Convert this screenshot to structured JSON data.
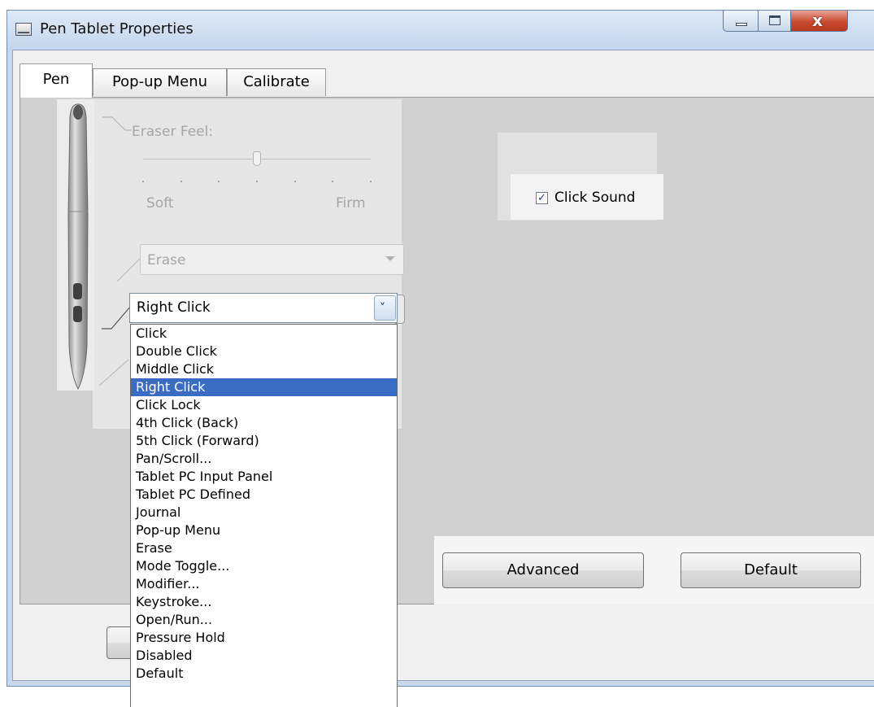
{
  "window": {
    "title": "Pen Tablet Properties"
  },
  "titlebar_buttons": [
    "minimize-icon",
    "maximize-icon",
    "close-icon"
  ],
  "close_glyph": "x",
  "tabs": [
    {
      "label": "Pen",
      "active": true
    },
    {
      "label": "Pop-up Menu",
      "active": false
    },
    {
      "label": "Calibrate",
      "active": false
    }
  ],
  "eraser_feel": {
    "label": "Eraser Feel:",
    "min_label": "Soft",
    "max_label": "Firm",
    "level_fraction": 0.5,
    "tick_count": 7,
    "enabled": false
  },
  "click_sound": {
    "label": "Click Sound",
    "checked": true,
    "check_glyph": "✓"
  },
  "eraser_button_select": {
    "value": "Erase",
    "enabled": false
  },
  "side_button_select": {
    "value": "Right Click",
    "expanded": true,
    "chevron": "˅",
    "options": [
      "Click",
      "Double Click",
      "Middle Click",
      "Right Click",
      "Click Lock",
      "4th Click (Back)",
      "5th Click (Forward)",
      "Pan/Scroll...",
      "Tablet PC Input Panel",
      "Tablet PC Defined",
      "Journal",
      "Pop-up Menu",
      "Erase",
      "Mode Toggle...",
      "Modifier...",
      "Keystroke...",
      "Open/Run...",
      "Pressure Hold",
      "Disabled",
      "Default"
    ],
    "selected_index": 3
  },
  "buttons": {
    "advanced": "Advanced",
    "default": "Default"
  },
  "colors": {
    "selection": "#3b6cc4",
    "close_button": "#c94a31",
    "panel": "#d1d1d1"
  }
}
